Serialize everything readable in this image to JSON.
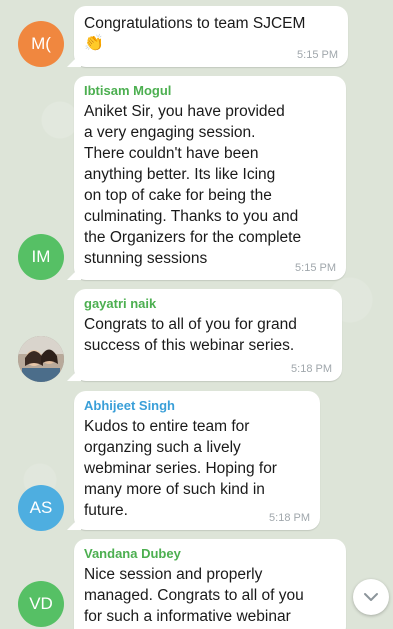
{
  "messages": [
    {
      "initials": "M(",
      "avatar_color": "#f0873f",
      "sender": "",
      "text": "Congratulations to team SJCEM",
      "emoji": "👏",
      "time": "5:15 PM"
    },
    {
      "initials": "IM",
      "avatar_color": "#56c065",
      "sender": "Ibtisam Mogul",
      "sender_color": "#4caf50",
      "text": "Aniket Sir, you have provided\na very engaging session.\nThere couldn't have been\nanything better. Its like Icing\non top of cake for being the\nculminating. Thanks to you and\nthe Organizers for the complete\nstunning sessions",
      "time": "5:15 PM"
    },
    {
      "initials": "",
      "avatar_icon": "profile-photo-icon",
      "sender": "gayatri naik",
      "sender_color": "#4caf50",
      "text": "Congrats to all of you for grand\nsuccess of this webinar series.",
      "time": "5:18 PM"
    },
    {
      "initials": "AS",
      "avatar_color": "#4eaee0",
      "sender": "Abhijeet Singh",
      "sender_color": "#3a9fd8",
      "text": "Kudos to entire team for\norganzing such a lively\nwebminar series. Hoping for\nmany more of such kind in\nfuture.",
      "time": "5:18 PM"
    },
    {
      "initials": "VD",
      "avatar_color": "#56c065",
      "sender": "Vandana Dubey",
      "sender_color": "#4caf50",
      "text": "Nice session and properly\nmanaged. Congrats to all of you\nfor such a informative webinar",
      "time": ""
    }
  ],
  "scroll_button": {
    "icon": "chevron-down-icon"
  }
}
